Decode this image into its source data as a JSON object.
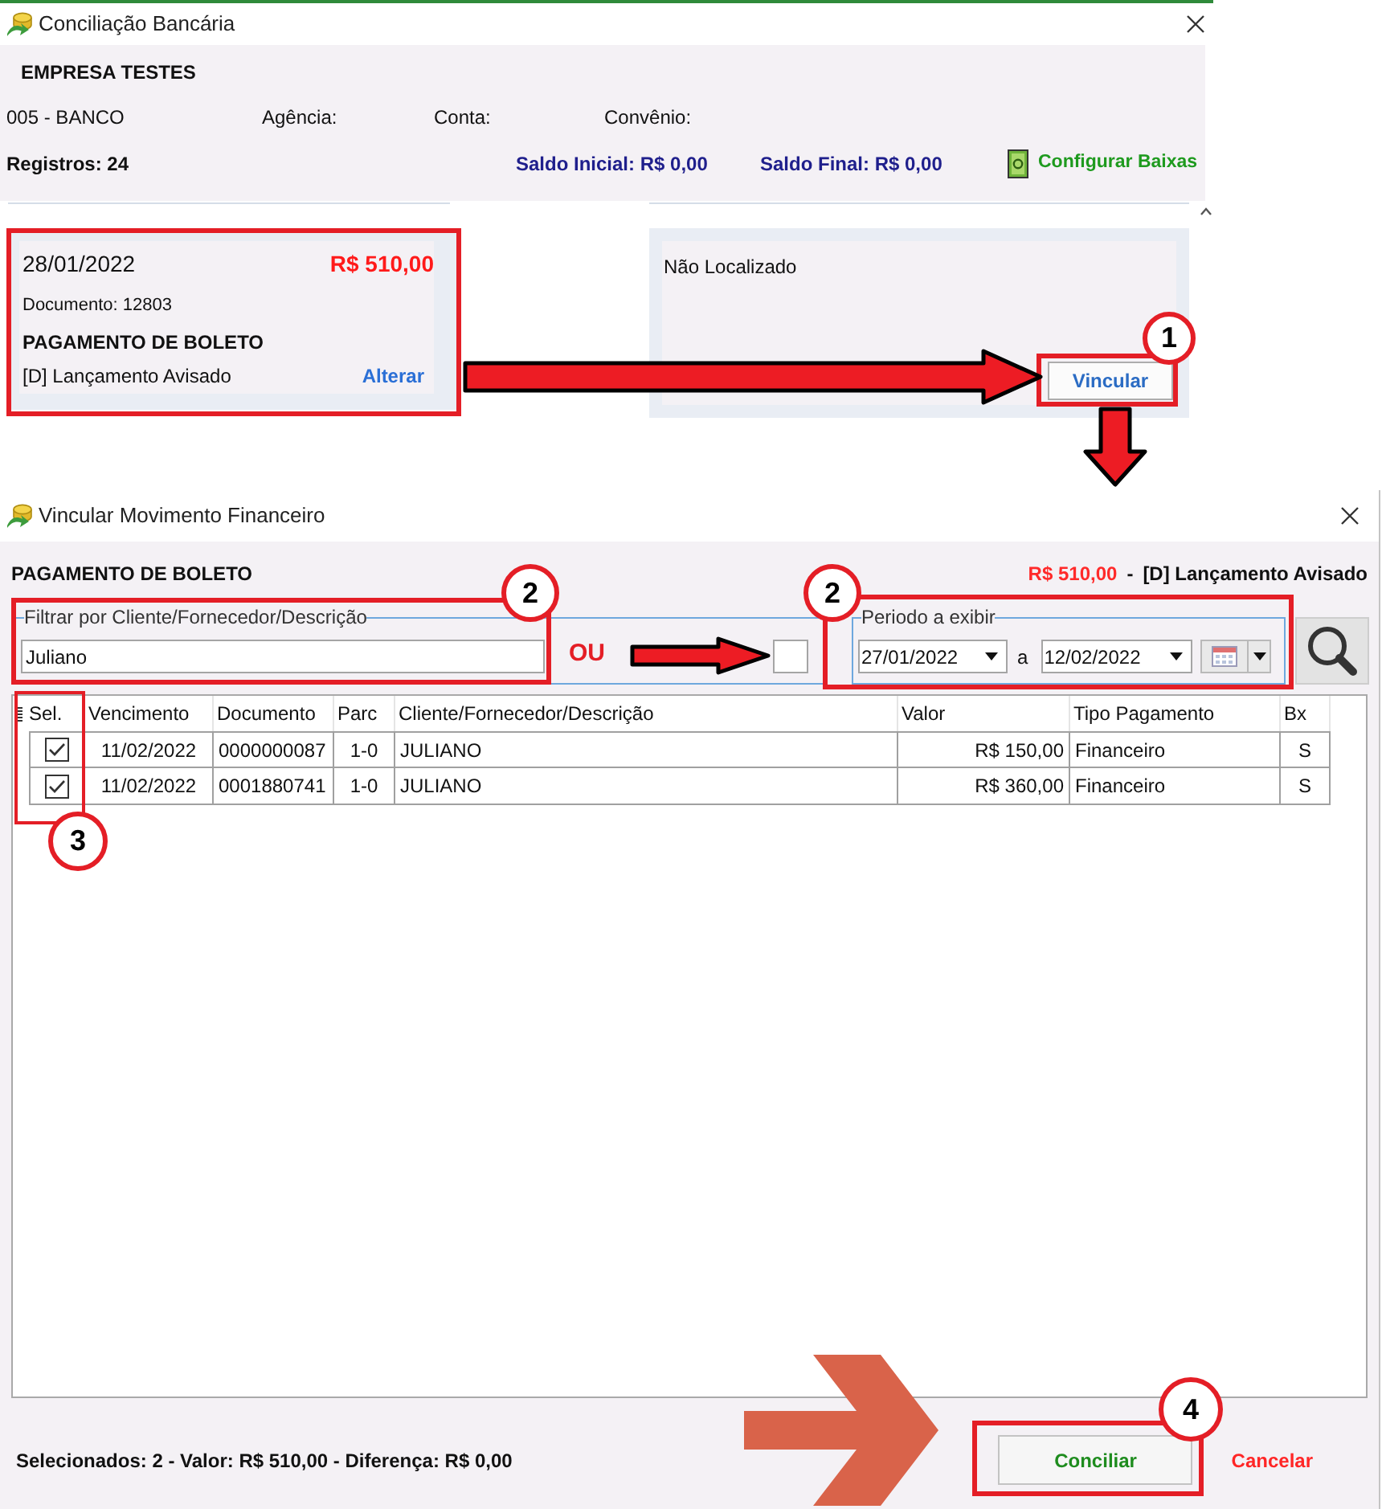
{
  "main_window": {
    "title": "Conciliação Bancária",
    "company": "EMPRESA TESTES",
    "bank": "005 - BANCO",
    "agency_label": "Agência:",
    "account_label": "Conta:",
    "agreement_label": "Convênio:",
    "records": "Registros: 24",
    "opening_balance": "Saldo Inicial: R$ 0,00",
    "closing_balance": "Saldo Final: R$ 0,00",
    "configure_link": "Configurar Baixas",
    "statement_entry": {
      "date": "28/01/2022",
      "amount": "R$ 510,00",
      "document": "Documento: 12803",
      "description": "PAGAMENTO DE BOLETO",
      "entry_type": "[D] Lançamento Avisado",
      "edit_link": "Alterar"
    },
    "match_panel": {
      "status": "Não Localizado",
      "link_button": "Vincular"
    }
  },
  "link_window": {
    "title": "Vincular Movimento Financeiro",
    "description": "PAGAMENTO DE BOLETO",
    "amount": "R$ 510,00",
    "separator": "-",
    "entry_type": "[D] Lançamento Avisado",
    "filter": {
      "label": "Filtrar por Cliente/Fornecedor/Descrição",
      "value": "Juliano"
    },
    "period": {
      "label": "Periodo a exibir",
      "start": "27/01/2022",
      "connector": "a",
      "end": "12/02/2022"
    },
    "table": {
      "columns": [
        "Sel.",
        "Vencimento",
        "Documento",
        "Parc",
        "Cliente/Fornecedor/Descrição",
        "Valor",
        "Tipo Pagamento",
        "Bx"
      ],
      "rows": [
        {
          "checked": true,
          "cells": [
            "",
            "11/02/2022",
            "0000000087",
            "1-0",
            "JULIANO",
            "R$ 150,00",
            "Financeiro",
            "S"
          ]
        },
        {
          "checked": true,
          "cells": [
            "",
            "11/02/2022",
            "0001880741",
            "1-0",
            "JULIANO",
            "R$ 360,00",
            "Financeiro",
            "S"
          ]
        }
      ]
    },
    "summary": "Selecionados: 2 - Valor: R$ 510,00 - Diferença: R$ 0,00",
    "buttons": [
      {
        "kind": "primary",
        "label": "Conciliar"
      },
      {
        "kind": "cancel",
        "label": "Cancelar"
      }
    ]
  },
  "annotations": {
    "step_markers": [
      "1",
      "2",
      "2",
      "3",
      "4"
    ],
    "or_label": "OU"
  }
}
